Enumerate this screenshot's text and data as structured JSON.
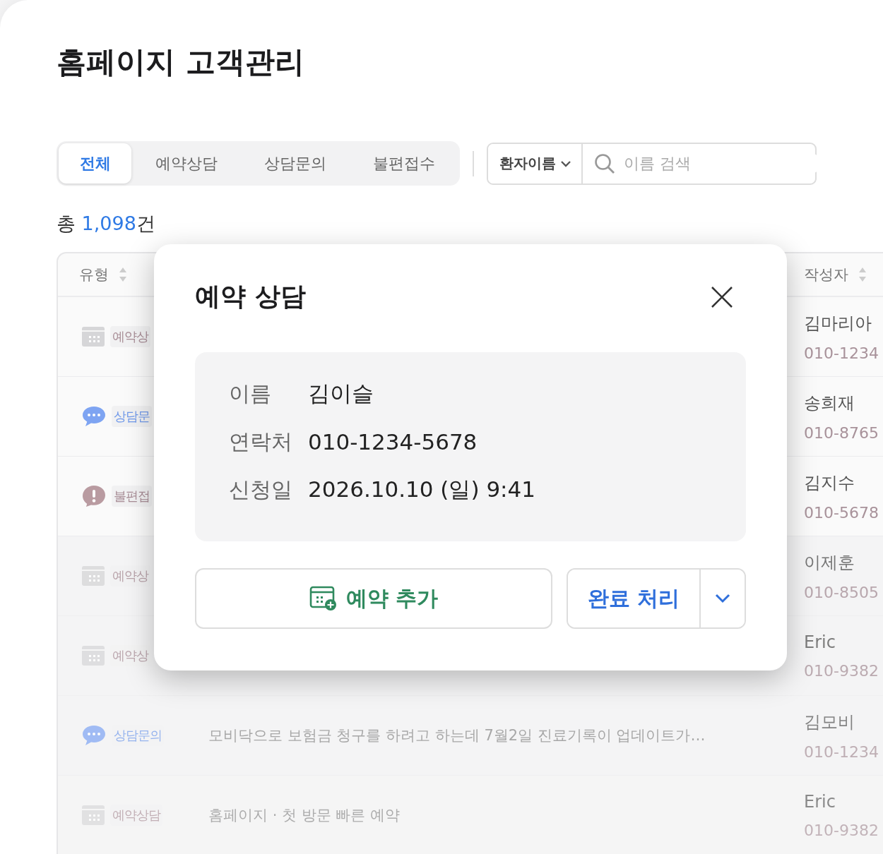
{
  "page": {
    "title": "홈페이지 고객관리"
  },
  "tabs": [
    {
      "label": "전체",
      "selected": true
    },
    {
      "label": "예약상담",
      "selected": false
    },
    {
      "label": "상담문의",
      "selected": false
    },
    {
      "label": "불편접수",
      "selected": false
    }
  ],
  "filter": {
    "field": "환자이름",
    "placeholder": "이름 검색"
  },
  "total": {
    "prefix": "총",
    "count": "1,098",
    "suffix": "건"
  },
  "table": {
    "columns": [
      {
        "label": "유형"
      },
      {
        "label": "작성자"
      }
    ],
    "rows": [
      {
        "kind": "reservation",
        "type": "예약상",
        "name": "김마리아",
        "phone": "010-1234"
      },
      {
        "kind": "inquiry",
        "type": "상담문",
        "name": "송희재",
        "phone": "010-8765"
      },
      {
        "kind": "complaint",
        "type": "불편접",
        "name": "김지수",
        "phone": "010-5678"
      },
      {
        "kind": "reservation",
        "type": "예약상",
        "name": "이제훈",
        "phone": "010-8505"
      },
      {
        "kind": "reservation",
        "type": "예약상",
        "name": "Eric",
        "phone": "010-9382"
      },
      {
        "kind": "inquiry",
        "type": "상담문의",
        "message": "모비닥으로 보험금 청구를 하려고 하는데 7월2일 진료기록이 업데이트가…",
        "name": "김모비",
        "phone": "010-1234"
      },
      {
        "kind": "reservation",
        "type": "예약상담",
        "message": "홈페이지 · 첫 방문 빠른 예약",
        "name": "Eric",
        "phone": "010-9382"
      }
    ]
  },
  "modal": {
    "title": "예약 상담",
    "fields": [
      {
        "label": "이름",
        "value": "김이슬"
      },
      {
        "label": "연락처",
        "value": "010-1234-5678"
      },
      {
        "label": "신청일",
        "value": "2026.10.10 (일) 9:41"
      }
    ],
    "add_button": "예약 추가",
    "complete_button": "완료 처리"
  }
}
